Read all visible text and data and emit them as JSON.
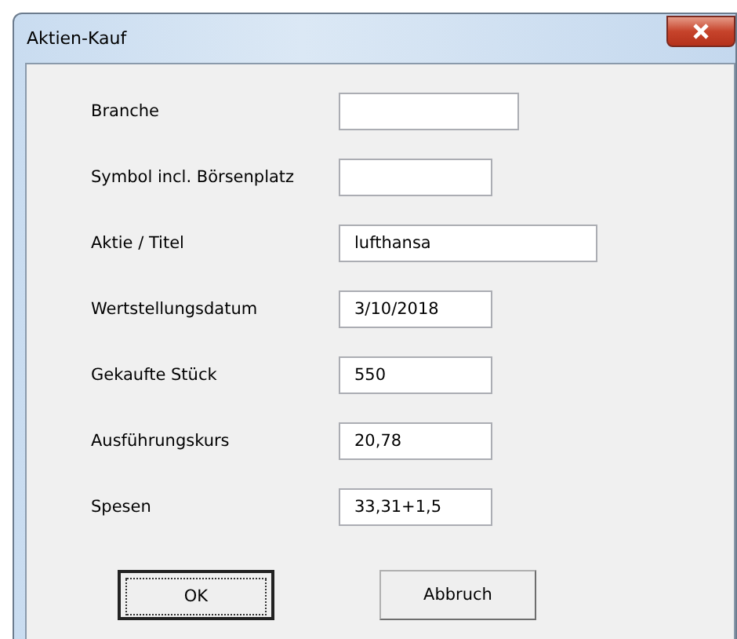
{
  "window": {
    "title": "Aktien-Kauf"
  },
  "fields": [
    {
      "label": "Branche"
    },
    {
      "label": "Symbol incl. Börsenplatz"
    },
    {
      "label": "Aktie / Titel",
      "value": "lufthansa"
    },
    {
      "label": "Wertstellungsdatum",
      "value": "3/10/2018"
    },
    {
      "label": "Gekaufte Stück",
      "value": "550"
    },
    {
      "label": "Ausführungskurs",
      "value": "20,78"
    },
    {
      "label": "Spesen",
      "value": "33,31+1,5"
    }
  ],
  "buttons": [
    {
      "label": "OK",
      "default": true
    },
    {
      "label": "Abbruch",
      "default": false
    }
  ]
}
